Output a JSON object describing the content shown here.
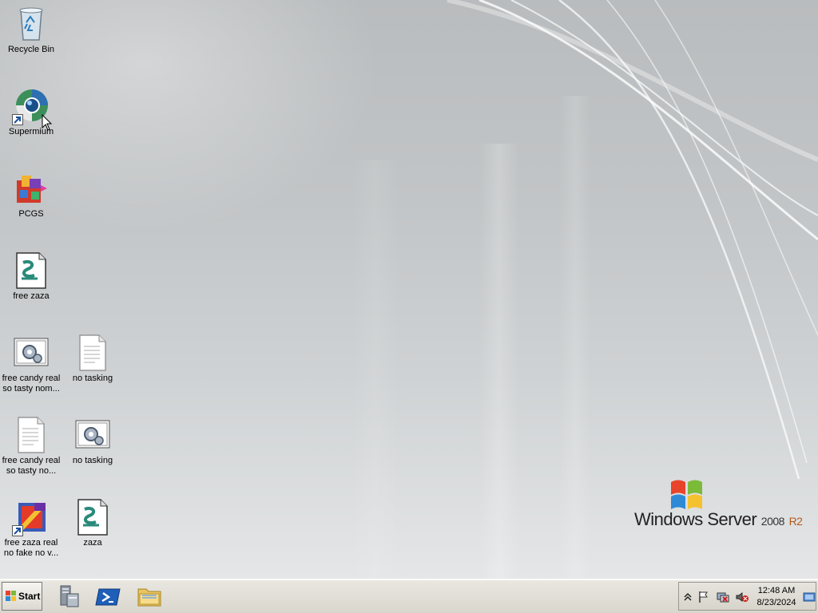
{
  "desktop": {
    "icons": [
      {
        "label": "Recycle Bin",
        "icon": "recycle-bin-icon"
      },
      {
        "label": "Supermium",
        "icon": "browser-globe-icon"
      },
      {
        "label": "PCGS",
        "icon": "pcgs-app-icon"
      },
      {
        "label": "free zaza",
        "icon": "script-file-icon"
      },
      {
        "label": "free candy real so tasty nom...",
        "icon": "settings-file-icon"
      },
      {
        "label": "no tasking",
        "icon": "text-file-icon"
      },
      {
        "label": "free candy real so tasty no...",
        "icon": "text-file-icon"
      },
      {
        "label": "no tasking",
        "icon": "settings-file-icon"
      },
      {
        "label": "free zaza real no fake no v...",
        "icon": "colorful-app-icon"
      },
      {
        "label": "zaza",
        "icon": "script-file-icon"
      }
    ]
  },
  "branding": {
    "product": "Windows Server",
    "version": "2008",
    "edition": "R2"
  },
  "taskbar": {
    "start_label": "Start",
    "pinned": [
      {
        "icon": "server-manager-icon"
      },
      {
        "icon": "powershell-icon"
      },
      {
        "icon": "folder-icon"
      }
    ],
    "tray": {
      "time": "12:48 AM",
      "date": "8/23/2024"
    }
  },
  "colors": {
    "taskbar": "#dcd9d0",
    "desktop_top": "#b9bcbe",
    "desktop_bottom": "#e4e6e7",
    "r2_accent": "#b55a1a"
  }
}
